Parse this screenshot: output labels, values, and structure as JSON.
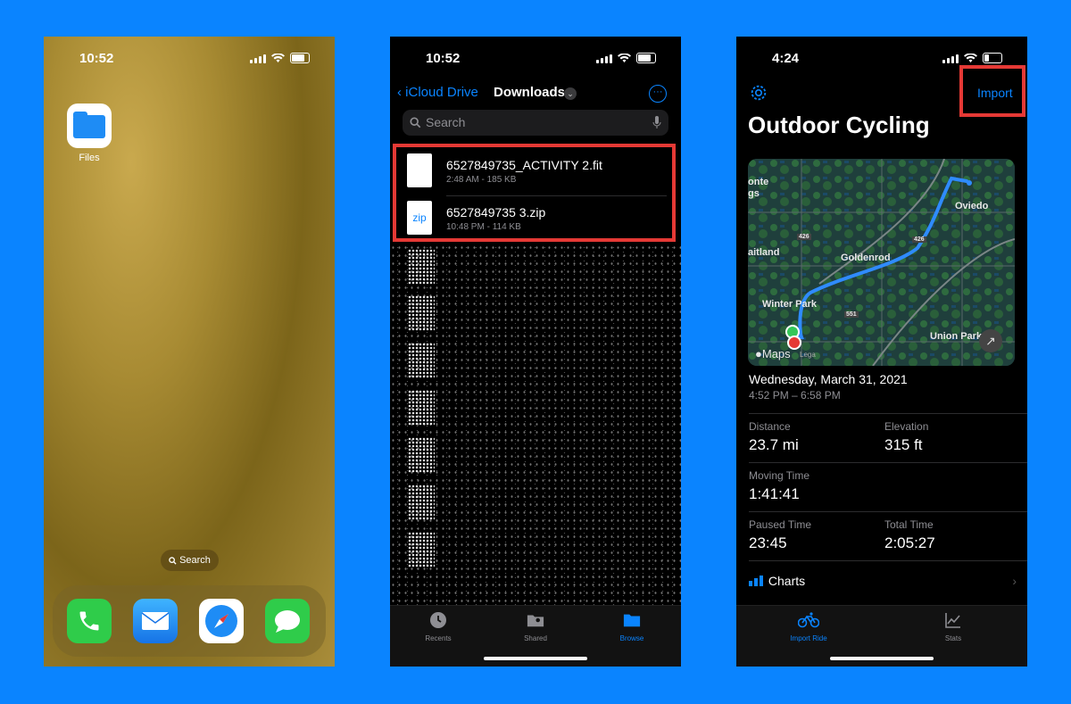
{
  "home": {
    "time": "10:52",
    "app_label": "Files",
    "search_label": "Search"
  },
  "files": {
    "time": "10:52",
    "back_label": "iCloud Drive",
    "title": "Downloads",
    "search_placeholder": "Search",
    "items": [
      {
        "name": "6527849735_ACTIVITY 2.fit",
        "meta": "2:48 AM - 185 KB",
        "icon": "doc"
      },
      {
        "name": "6527849735 3.zip",
        "meta": "10:48 PM - 114 KB",
        "icon": "zip"
      }
    ],
    "zip_icon_label": "zip",
    "tabs": [
      {
        "label": "Recents",
        "icon": "clock-icon"
      },
      {
        "label": "Shared",
        "icon": "shared-folder-icon"
      },
      {
        "label": "Browse",
        "icon": "folder-icon"
      }
    ]
  },
  "fitness": {
    "time": "4:24",
    "import_label": "Import",
    "title": "Outdoor Cycling",
    "map_labels": {
      "city1": "Oviedo",
      "city2": "Goldenrod",
      "city3": "Winter Park",
      "city4": "Union Park",
      "city5": "aitland",
      "city6": "onte",
      "city7": "gs",
      "road1": "426",
      "road2": "426",
      "road3": "551",
      "maps_brand": "Maps",
      "legal": "Lega"
    },
    "date": "Wednesday, March 31, 2021",
    "time_range": "4:52 PM – 6:58 PM",
    "stats": {
      "distance_label": "Distance",
      "distance_value": "23.7 mi",
      "elevation_label": "Elevation",
      "elevation_value": "315 ft",
      "moving_label": "Moving Time",
      "moving_value": "1:41:41",
      "paused_label": "Paused Time",
      "paused_value": "23:45",
      "total_label": "Total Time",
      "total_value": "2:05:27"
    },
    "charts_label": "Charts",
    "tabs": [
      {
        "label": "Import Ride",
        "icon": "bicycle-icon"
      },
      {
        "label": "Stats",
        "icon": "chart-icon"
      }
    ]
  },
  "colors": {
    "accent": "#0a84ff",
    "highlight": "#e53935",
    "background": "#0a84ff"
  }
}
